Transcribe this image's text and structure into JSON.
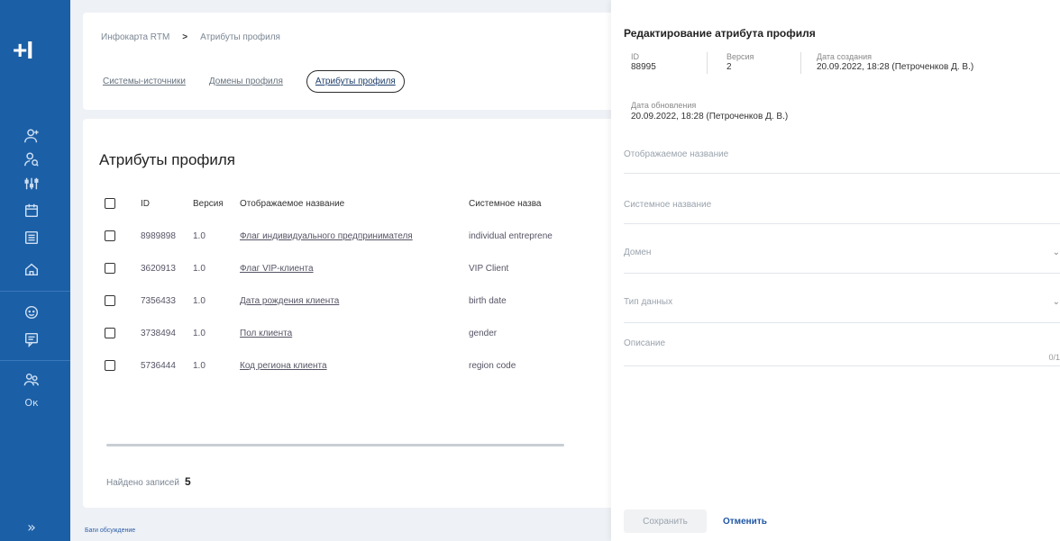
{
  "app": {
    "logo": "+I"
  },
  "sidebar": {
    "icons": [
      "user-add-icon",
      "user-search-icon",
      "settings-sliders-icon",
      "calendar-icon",
      "list-icon",
      "home-icon",
      "support-icon",
      "chat-icon",
      "people-icon"
    ],
    "text_icon": "Ок",
    "collapse": "»"
  },
  "breadcrumb": {
    "root": "Инфокарта RTM",
    "sep": ">",
    "current": "Атрибуты профиля"
  },
  "tabs": [
    "Системы-источники",
    "Домены профиля",
    "Атрибуты профиля"
  ],
  "page": {
    "title": "Атрибуты профиля"
  },
  "table": {
    "headers": {
      "id": "ID",
      "version": "Версия",
      "display_name": "Отображаемое название",
      "system_name": "Системное назва"
    },
    "rows": [
      {
        "id": "8989898",
        "version": "1.0",
        "display_name": "Флаг индивидуального предпринимателя",
        "system_name": "individual entreprene"
      },
      {
        "id": "3620913",
        "version": "1.0",
        "display_name": "Флаг VIP-клиента",
        "system_name": "VIP Client"
      },
      {
        "id": "7356433",
        "version": "1.0",
        "display_name": "Дата рождения клиента",
        "system_name": "birth date"
      },
      {
        "id": "3738494",
        "version": "1.0",
        "display_name": "Пол клиента",
        "system_name": "gender"
      },
      {
        "id": "5736444",
        "version": "1.0",
        "display_name": "Код региона клиента",
        "system_name": "region code"
      }
    ]
  },
  "footer": {
    "found_label": "Найдено записей",
    "found_count": "5",
    "link": "Баги обсуждение"
  },
  "drawer": {
    "title": "Редактирование атрибута профиля",
    "id_label": "ID",
    "id_value": "88995",
    "version_label": "Версия",
    "version_value": "2",
    "created_label": "Дата создания",
    "created_value": "20.09.2022, 18:28 (Петроченков Д. В.)",
    "updated_label": "Дата обновления",
    "updated_value": "20.09.2022, 18:28 (Петроченков Д. В.)",
    "fields": {
      "display_name": "Отображаемое название",
      "system_name": "Системное название",
      "domain": "Домен",
      "data_type": "Тип данных",
      "description": "Описание"
    },
    "description_hint": "0/1",
    "save": "Сохранить",
    "cancel": "Отменить"
  }
}
